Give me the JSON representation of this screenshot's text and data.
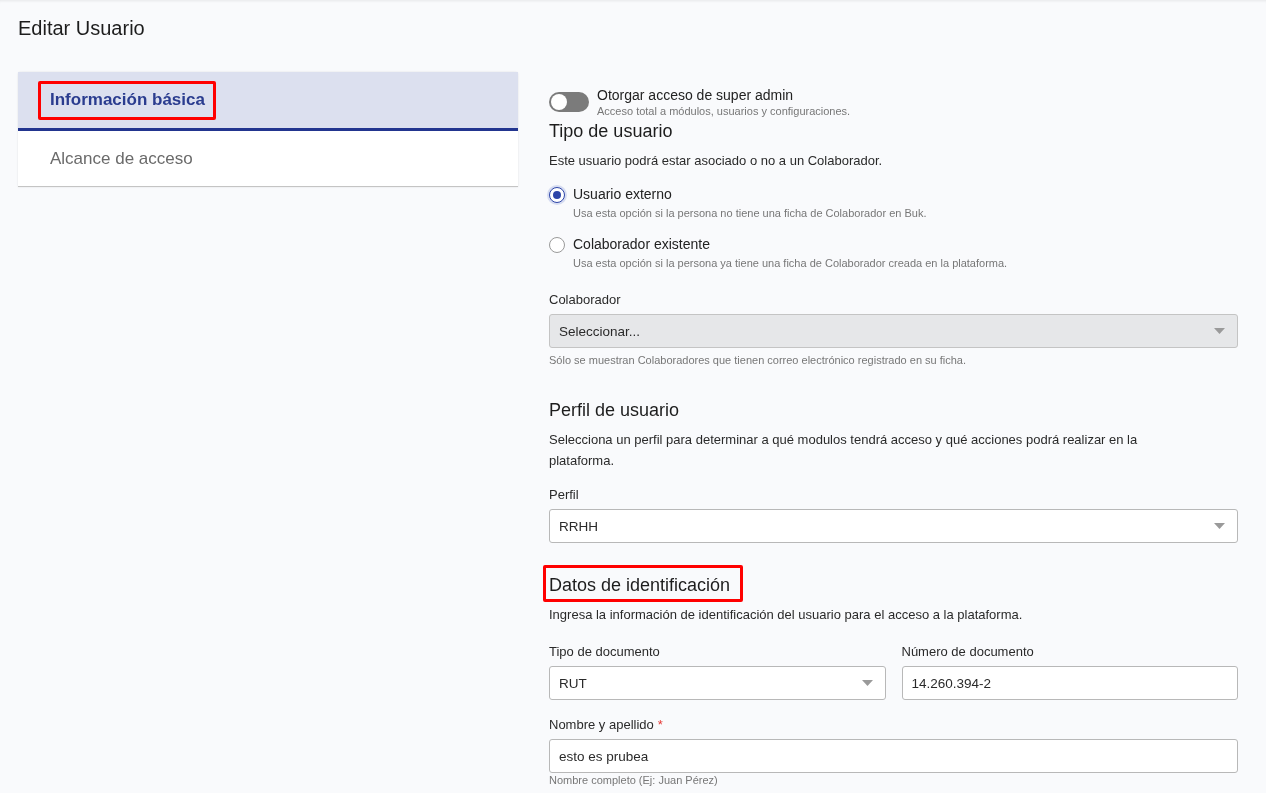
{
  "page": {
    "title": "Editar Usuario"
  },
  "sidebar": {
    "tabs": [
      {
        "label": "Información básica",
        "selected": true,
        "highlighted": true
      },
      {
        "label": "Alcance de acceso",
        "selected": false,
        "highlighted": false
      }
    ]
  },
  "super_admin": {
    "label": "Otorgar acceso de super admin",
    "description": "Acceso total a módulos, usuarios y configuraciones.",
    "on": false
  },
  "user_type": {
    "heading": "Tipo de usuario",
    "highlighted": false,
    "description": "Este usuario podrá estar asociado o no a un Colaborador.",
    "options": [
      {
        "label": "Usuario externo",
        "hint": "Usa esta opción si la persona no tiene una ficha de Colaborador en Buk.",
        "selected": true
      },
      {
        "label": "Colaborador existente",
        "hint": "Usa esta opción si la persona ya tiene una ficha de Colaborador creada en la plataforma.",
        "selected": false
      }
    ],
    "collaborator": {
      "label": "Colaborador",
      "placeholder": "Seleccionar...",
      "disabled": true,
      "hint": "Sólo se muestran Colaboradores que tienen correo electrónico registrado en su ficha."
    }
  },
  "profile": {
    "heading": "Perfil de usuario",
    "highlighted": false,
    "description": "Selecciona un perfil para determinar a qué modulos tendrá acceso y qué acciones podrá realizar en la plataforma.",
    "field": {
      "label": "Perfil",
      "value": "RRHH",
      "disabled": false
    }
  },
  "identification": {
    "heading": "Datos de identificación",
    "highlighted": true,
    "description": "Ingresa la información de identificación del usuario para el acceso a la plataforma.",
    "rows": [
      [
        {
          "kind": "select",
          "label": "Tipo de documento",
          "value": "RUT"
        },
        {
          "kind": "text",
          "label": "Número de documento",
          "value": "14.260.394-2"
        }
      ],
      [
        {
          "kind": "text",
          "label": "Nombre y apellido",
          "required_mark": "*",
          "value": "esto es prubea",
          "hint": "Nombre completo (Ej: Juan Pérez)"
        }
      ]
    ]
  }
}
